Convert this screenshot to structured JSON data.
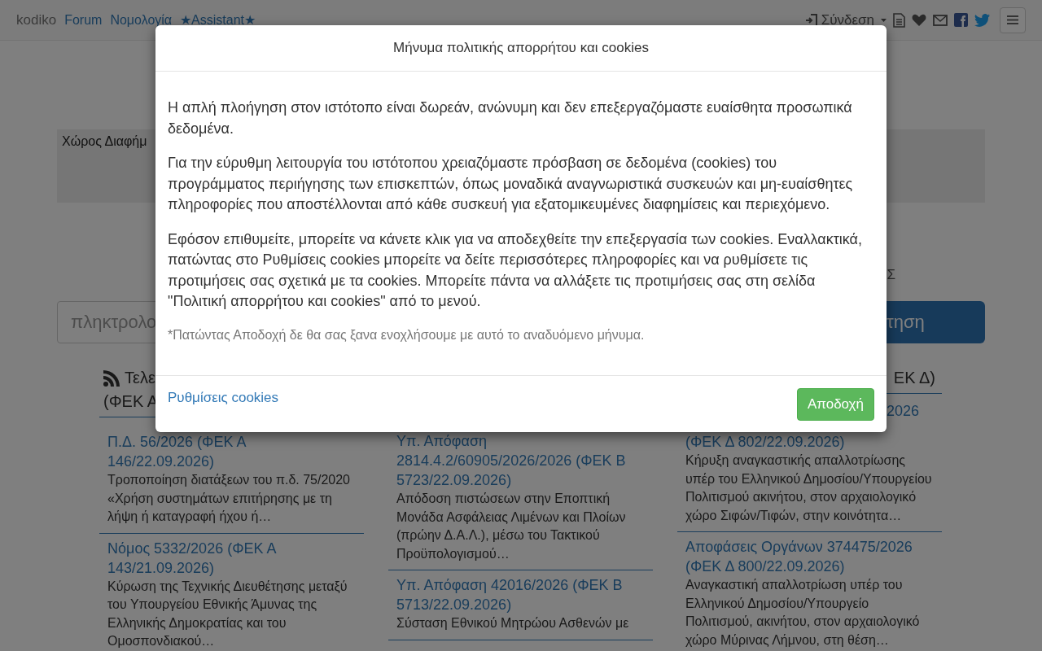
{
  "navbar": {
    "brand": "kodiko",
    "links": [
      "Forum",
      "Νομολογία",
      "★Assistant★"
    ],
    "login": "Σύνδεση"
  },
  "ad_box": {
    "label": "Χώρος Διαφήμ"
  },
  "text_fragment": "Σ",
  "search": {
    "placeholder": "πληκτρολο",
    "button": "τηση"
  },
  "columns": [
    {
      "heading_lines": [
        "Τελε",
        "(ΦΕΚ Α"
      ],
      "items": [
        {
          "title": [
            "Π.Δ. 56/2026 (ΦΕΚ Α 146/22.09.2026)"
          ],
          "summary": "Τροποποίηση διατάξεων του π.δ. 75/2020 «Χρήση συστημάτων επιτήρησης με τη λήψη ή καταγραφή ήχου ή…"
        },
        {
          "title": [
            "Νόμος 5332/2026 (ΦΕΚ Α 143/21.09.2026)"
          ],
          "summary": "Κύρωση της Τεχνικής Διευθέτησης μεταξύ του Υπουργείου Εθνικής Άμυνας της Ελληνικής Δημοκρατίας και του Ομοσπονδιακού…"
        }
      ]
    },
    {
      "items": [
        {
          "title": [
            "Υπ. Απόφαση 2814.4.2/60905/2026/2026 (ΦΕΚ Β 5723/22.09.2026)"
          ],
          "summary": "Απόδοση πιστώσεων στην Εποπτική Μονάδα Ασφάλειας Λιμένων και Πλοίων (πρώην Δ.Α.Λ.), μέσω του Τακτικού Προϋπολογισμού…"
        },
        {
          "title": [
            "Υπ. Απόφαση 42016/2026 (ΦΕΚ Β 5713/22.09.2026)"
          ],
          "summary": "Σύσταση Εθνικού Μητρώου Ασθενών με"
        }
      ]
    },
    {
      "heading_lines": [
        "ΕΚ Δ)"
      ],
      "items": [
        {
          "title": [
            "2026",
            "(ΦΕΚ Δ 802/22.09.2026)"
          ],
          "summary": "Κήρυξη αναγκαστικής απαλλοτρίωσης υπέρ του Ελληνικού Δημοσίου/Υπουργείου Πολιτισμού ακινήτου, στον αρχαιολογικό χώρο Σιφών/Τιφών, στην κοινότητα…"
        },
        {
          "title": [
            "Αποφάσεις Οργάνων 374475/2026 (ΦΕΚ Δ 800/22.09.2026)"
          ],
          "summary": "Αναγκαστική απαλλοτρίωση υπέρ του Ελληνικού Δημοσίου/Υπουργείο Πολιτισμού, ακινήτου, στον αρχαιολογικό χώρο Μύρινας Λήμνου, στη θέση…"
        }
      ]
    }
  ],
  "modal": {
    "title": "Μήνυμα πολιτικής απορρήτου και cookies",
    "paragraphs": [
      "Η απλή πλοήγηση στον ιστότοπο είναι δωρεάν, ανώνυμη και δεν επεξεργαζόμαστε ευαίσθητα προσωπικά δεδομένα.",
      "Για την εύρυθμη λειτουργία του ιστότοπου χρειαζόμαστε πρόσβαση σε δεδομένα (cookies) του προγράμματος περιήγησης των επισκεπτών, όπως μοναδικά αναγνωριστικά συσκευών και μη-ευαίσθητες πληροφορίες που αποστέλλονται από κάθε συσκευή για εξατομικευμένες διαφημίσεις και περιεχόμενο.",
      "Εφόσον επιθυμείτε, μπορείτε να κάνετε κλικ για να αποδεχθείτε την επεξεργασία των cookies. Εναλλακτικά, πατώντας στο Ρυθμίσεις cookies μπορείτε να δείτε περισσότερες πληροφορίες και να ρυθμίσετε τις προτιμήσεις σας σχετικά με τα cookies. Μπορείτε πάντα να αλλάξετε τις προτιμήσεις σας στη σελίδα \"Πολιτική απορρήτου και cookies\" από το μενού."
    ],
    "note": "*Πατώντας Αποδοχή δε θα σας ξανα ενοχλήσουμε με αυτό το αναδυόμενο μήνυμα.",
    "settings_link": "Ρυθμίσεις cookies",
    "accept_button": "Αποδοχή"
  }
}
